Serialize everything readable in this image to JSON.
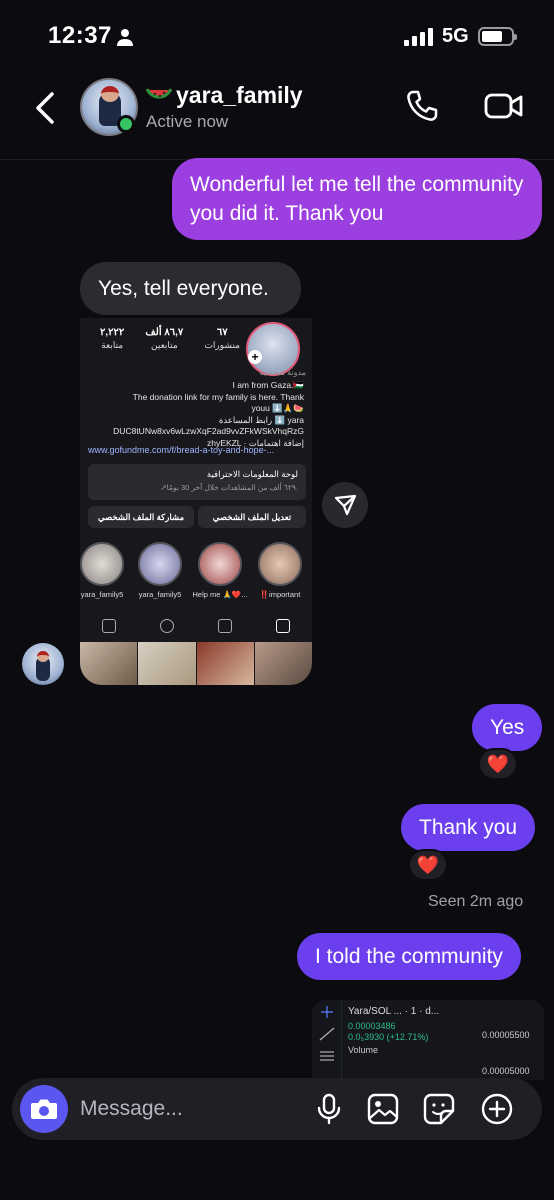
{
  "status_bar": {
    "time": "12:37",
    "network": "5G"
  },
  "header": {
    "name": "yara_family",
    "status": "Active now",
    "name_emoji": "watermelon-icon"
  },
  "messages": [
    {
      "id": "m1",
      "direction": "outgoing",
      "text": "Wonderful let me tell the community you did it. Thank you"
    },
    {
      "id": "m2",
      "direction": "incoming",
      "text": "Yes, tell everyone."
    },
    {
      "id": "m3",
      "direction": "outgoing",
      "text": "Yes",
      "reaction": "❤️"
    },
    {
      "id": "m4",
      "direction": "outgoing",
      "text": "Thank you",
      "reaction": "❤️"
    },
    {
      "id": "m5",
      "direction": "outgoing",
      "text": "I told the community"
    }
  ],
  "seen_text": "Seen 2m ago",
  "shared_profile": {
    "stats": [
      {
        "value": "٦٧",
        "label": "منشورات"
      },
      {
        "value": "٨٦,٧ ألف",
        "label": "متابعين"
      },
      {
        "value": "٢,٢٢٢",
        "label": "متابعة"
      }
    ],
    "category": "مدونة شخصية",
    "bio_lines": [
      "I am from Gaza.🇵🇸",
      "The donation link for my family is here. Thank",
      "youu ⬇️🙏🍉",
      "رابط المساعدة ⬇️ yara",
      "DUC8tUNw8xv6wLzwXqF2ad9vvZFkWSkVhqRzG",
      "zhyEKZL · إضافة اهتمامات"
    ],
    "link": "www.gofundme.com/f/bread-a-toy-and-hope-...",
    "dashboard_title": "لوحة المعلومات الاحترافية",
    "dashboard_sub": "↗٦٢٩ ألف من المشاهدات خلال آخر 30 يومًا.",
    "btn_edit": "تعديل الملف الشخصي",
    "btn_share": "مشاركة الملف الشخصي",
    "highlights": [
      "yara_family5",
      "yara_family5",
      "Help me 🙏❤️...",
      "‼️important"
    ]
  },
  "shared_chart": {
    "title": "Yara/SOL ... · 1 · d...",
    "price": "0.00003486",
    "change": "0.0₅3930 (+12.71%)",
    "volume_label": "Volume",
    "axis_ticks": [
      "0.00005500",
      "0.00005000"
    ]
  },
  "composer": {
    "placeholder": "Message..."
  },
  "colors": {
    "outgoing_purple": "#9c3fe0",
    "outgoing_indigo": "#6b3fee",
    "incoming": "#2b2b31",
    "active_green": "#37c463",
    "camera_button": "#5b56f0"
  }
}
